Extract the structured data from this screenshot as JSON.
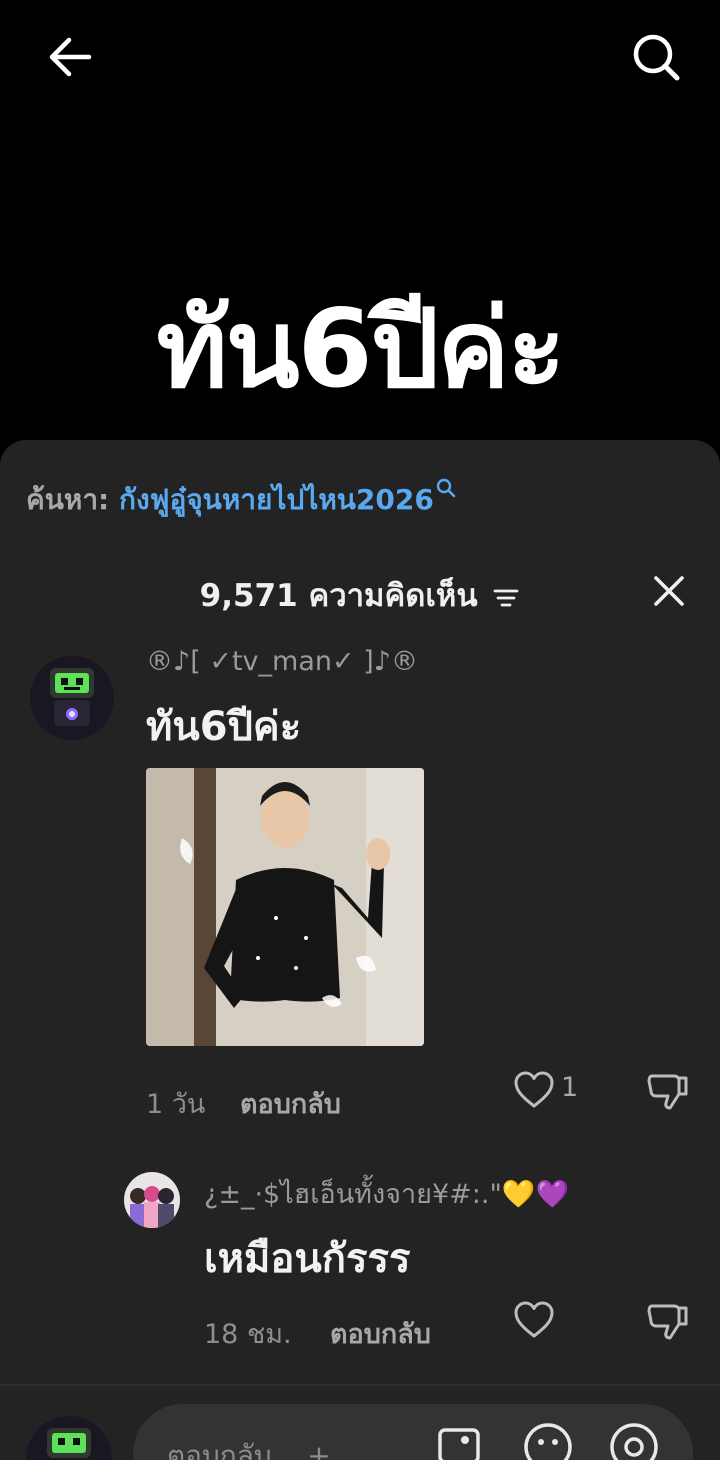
{
  "video": {
    "caption": "ทัน6ปีค่ะ"
  },
  "search_suggest": {
    "prefix": "ค้นหา:",
    "term": "กังฟูอู๋จุนหายไปไหน2026"
  },
  "comments_header": {
    "title": "9,571 ความคิดเห็น"
  },
  "comments": [
    {
      "username": "®♪[ ✓tv_man✓ ]♪®",
      "text": "ทัน6ปีค่ะ",
      "time": "1 วัน",
      "reply_label": "ตอบกลับ",
      "like_count": "1"
    },
    {
      "username": "¿±_·$ไฮเอ็นทั้งจาย¥#:.\"💛💜",
      "text": "เหมือนกัรรร",
      "time": "18 ชม.",
      "reply_label": "ตอบกลับ"
    }
  ],
  "input": {
    "placeholder": "ตอบกลับ ...+"
  }
}
